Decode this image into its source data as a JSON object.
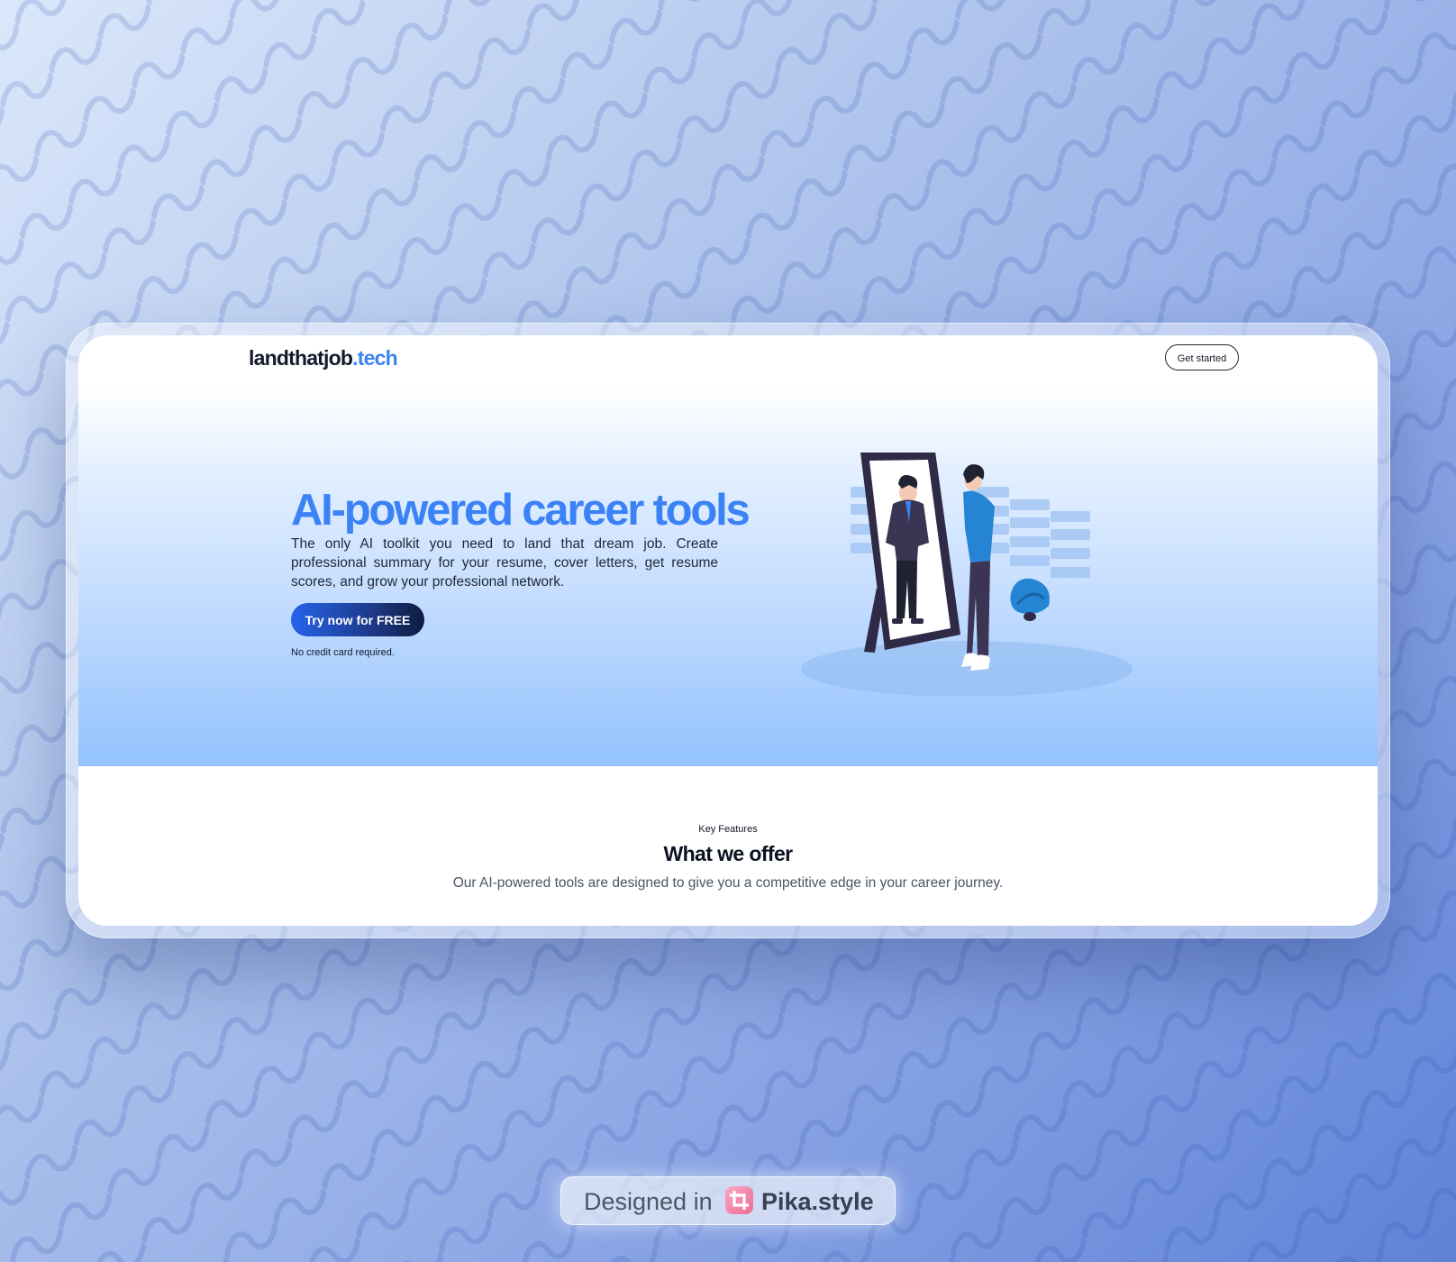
{
  "brand": {
    "name": "landthatjob",
    "tld": ".tech"
  },
  "nav": {
    "get_started_label": "Get started"
  },
  "hero": {
    "title": "AI-powered career tools",
    "description": "The only AI toolkit you need to land that dream job. Create professional summary for your resume, cover letters, get resume scores, and grow your professional network.",
    "cta_label": "Try now for FREE",
    "note": "No credit card required."
  },
  "features": {
    "eyebrow": "Key Features",
    "title": "What we offer",
    "subtitle": "Our AI-powered tools are designed to give you a competitive edge in your career journey."
  },
  "watermark": {
    "prefix": "Designed in",
    "brand": "Pika.style",
    "icon": "crop-icon"
  },
  "colors": {
    "accent": "#3b82f6",
    "cta_start": "#2563eb",
    "cta_end": "#0f1c3f",
    "hero_bottom": "#93c2fd",
    "badge_icon": "#ec6c95"
  }
}
